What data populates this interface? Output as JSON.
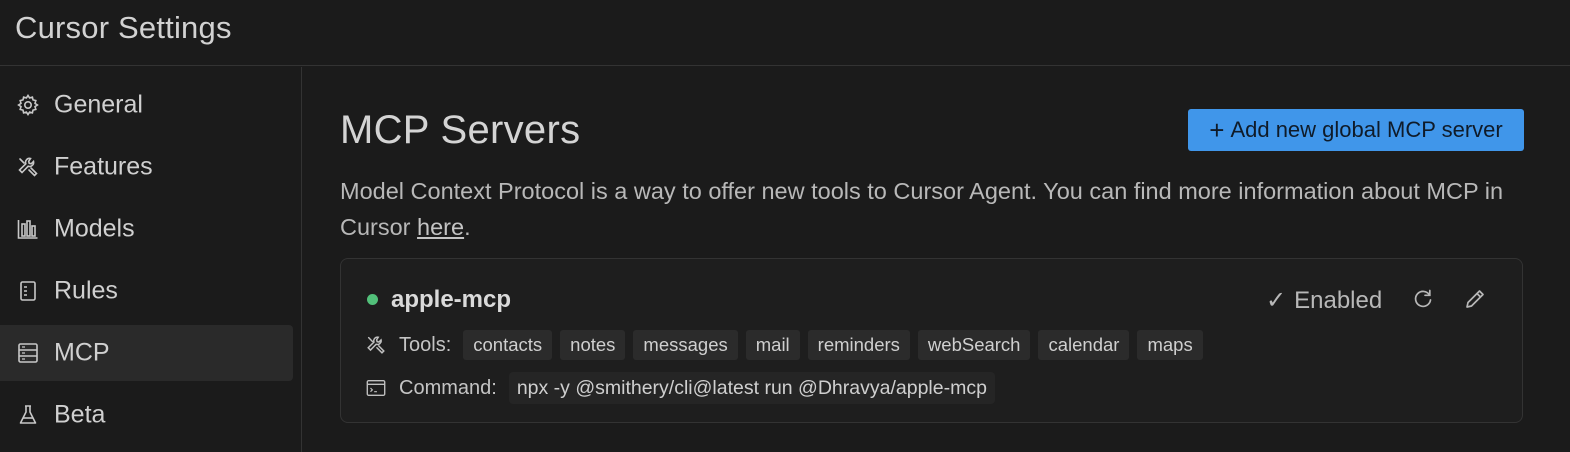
{
  "window": {
    "title": "Cursor Settings"
  },
  "sidebar": {
    "items": [
      {
        "label": "General",
        "icon": "gear-icon",
        "active": false
      },
      {
        "label": "Features",
        "icon": "tools-icon",
        "active": false
      },
      {
        "label": "Models",
        "icon": "bar-chart-icon",
        "active": false
      },
      {
        "label": "Rules",
        "icon": "document-icon",
        "active": false
      },
      {
        "label": "MCP",
        "icon": "server-icon",
        "active": true
      },
      {
        "label": "Beta",
        "icon": "flask-icon",
        "active": false
      }
    ]
  },
  "main": {
    "title": "MCP Servers",
    "add_button": {
      "icon": "+",
      "label": "Add new global MCP server"
    },
    "description": {
      "text_before": "Model Context Protocol is a way to offer new tools to Cursor Agent. You can find more information about MCP in Cursor ",
      "link": "here",
      "text_after": "."
    },
    "server": {
      "name": "apple-mcp",
      "status_color": "#52c07a",
      "status_label": "Enabled",
      "check_glyph": "✓",
      "tools_label": "Tools:",
      "tools": [
        "contacts",
        "notes",
        "messages",
        "mail",
        "reminders",
        "webSearch",
        "calendar",
        "maps"
      ],
      "command_label": "Command:",
      "command": "npx -y @smithery/cli@latest run @Dhravya/apple-mcp"
    }
  },
  "colors": {
    "background": "#1b1b1b",
    "accent": "#4096ea",
    "status_enabled": "#52c07a"
  }
}
